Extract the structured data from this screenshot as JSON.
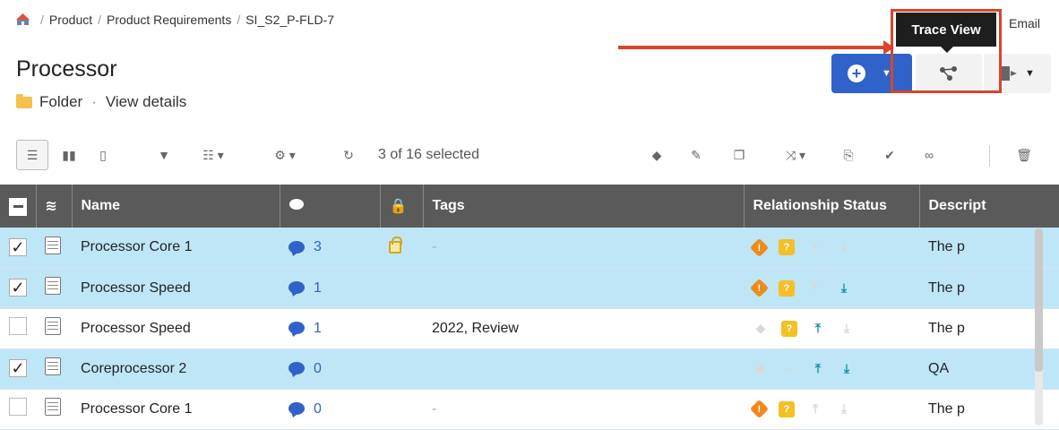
{
  "breadcrumb": [
    "Product",
    "Product Requirements",
    "SI_S2_P-FLD-7"
  ],
  "page_title": "Processor",
  "subline": {
    "type": "Folder",
    "details_link": "View details"
  },
  "header_actions": {
    "email": "Email",
    "tooltip": "Trace View"
  },
  "toolbar": {
    "selected_count": "3 of 16 selected"
  },
  "table": {
    "headers": {
      "name": "Name",
      "tags": "Tags",
      "relationship_status": "Relationship Status",
      "description": "Descript"
    },
    "rows": [
      {
        "selected": true,
        "checkmark": "✓",
        "name": "Processor Core 1",
        "comments": "3",
        "locked": true,
        "tags": "-",
        "description": "The p"
      },
      {
        "selected": true,
        "checkmark": "✓",
        "name": "Processor Speed",
        "comments": "1",
        "locked": false,
        "tags": "",
        "description": "The p"
      },
      {
        "selected": false,
        "checkmark": "",
        "name": "Processor Speed",
        "comments": "1",
        "locked": false,
        "tags": "2022, Review",
        "description": "The p"
      },
      {
        "selected": true,
        "checkmark": "✓",
        "name": "Coreprocessor 2",
        "comments": "0",
        "locked": false,
        "tags": "",
        "description": "QA"
      },
      {
        "selected": false,
        "checkmark": "",
        "name": "Processor Core 1",
        "comments": "0",
        "locked": false,
        "tags": "-",
        "description": "The p"
      }
    ]
  },
  "colors": {
    "primary": "#2f63c9",
    "selected_row": "#bfe6f7",
    "header_bg": "#5a5a5a",
    "annotation": "#d9442b",
    "orange": "#f08a1a",
    "yellow": "#f5c024",
    "teal": "#1a8fa6"
  }
}
